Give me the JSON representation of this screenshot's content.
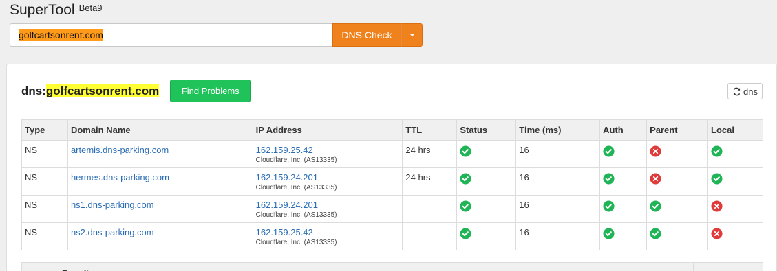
{
  "app": {
    "title": "SuperTool",
    "badge": "Beta9"
  },
  "search": {
    "value": "golfcartsonrent.com",
    "button_label": "DNS Check"
  },
  "panel": {
    "prefix": "dns:",
    "domain": "golfcartsonrent.com",
    "find_button": "Find Problems",
    "refresh_label": "dns"
  },
  "table": {
    "headers": [
      "Type",
      "Domain Name",
      "IP Address",
      "TTL",
      "Status",
      "Time (ms)",
      "Auth",
      "Parent",
      "Local"
    ],
    "rows": [
      {
        "type": "NS",
        "domain": "artemis.dns-parking.com",
        "ip": "162.159.25.42",
        "asn": "Cloudflare, Inc. (AS13335)",
        "ttl": "24 hrs",
        "status": "ok",
        "time": "16",
        "auth": "ok",
        "parent": "fail",
        "local": "ok"
      },
      {
        "type": "NS",
        "domain": "hermes.dns-parking.com",
        "ip": "162.159.24.201",
        "asn": "Cloudflare, Inc. (AS13335)",
        "ttl": "24 hrs",
        "status": "ok",
        "time": "16",
        "auth": "ok",
        "parent": "fail",
        "local": "ok"
      },
      {
        "type": "NS",
        "domain": "ns1.dns-parking.com",
        "ip": "162.159.24.201",
        "asn": "Cloudflare, Inc. (AS13335)",
        "ttl": "",
        "status": "ok",
        "time": "16",
        "auth": "ok",
        "parent": "ok",
        "local": "fail"
      },
      {
        "type": "NS",
        "domain": "ns2.dns-parking.com",
        "ip": "162.159.25.42",
        "asn": "Cloudflare, Inc. (AS13335)",
        "ttl": "",
        "status": "ok",
        "time": "16",
        "auth": "ok",
        "parent": "ok",
        "local": "fail"
      }
    ]
  },
  "results": {
    "header": "Result"
  },
  "colors": {
    "ok": "#1fb455",
    "fail": "#e03b3b",
    "accent": "#f0821e",
    "find": "#1fc35a",
    "highlight": "#ffff33"
  }
}
